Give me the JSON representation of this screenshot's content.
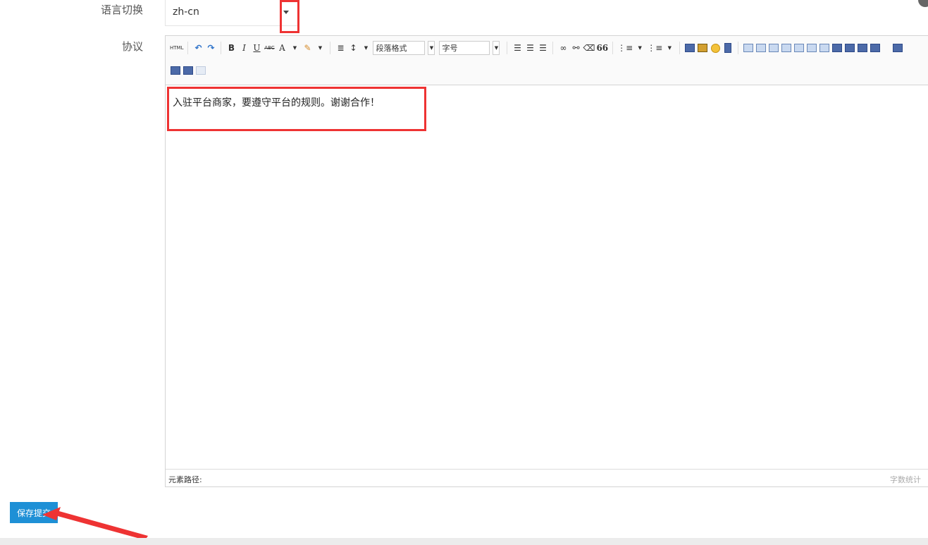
{
  "form": {
    "language_label": "语言切换",
    "language_value": "zh-cn",
    "agreement_label": "协议"
  },
  "editor": {
    "toolbar": {
      "html_btn": "HTML",
      "bold": "B",
      "italic": "I",
      "underline": "U",
      "strike": "ABC",
      "font_color": "A",
      "paragraph_format": "段落格式",
      "font_size": "字号",
      "quote": "66"
    },
    "content_text": "入驻平台商家，要遵守平台的规则。谢谢合作！",
    "status_path_label": "元素路径:",
    "word_count_label": "字数统计"
  },
  "actions": {
    "save_label": "保存提交"
  },
  "colors": {
    "accent": "#1e90d6",
    "highlight": "#ee3333"
  }
}
